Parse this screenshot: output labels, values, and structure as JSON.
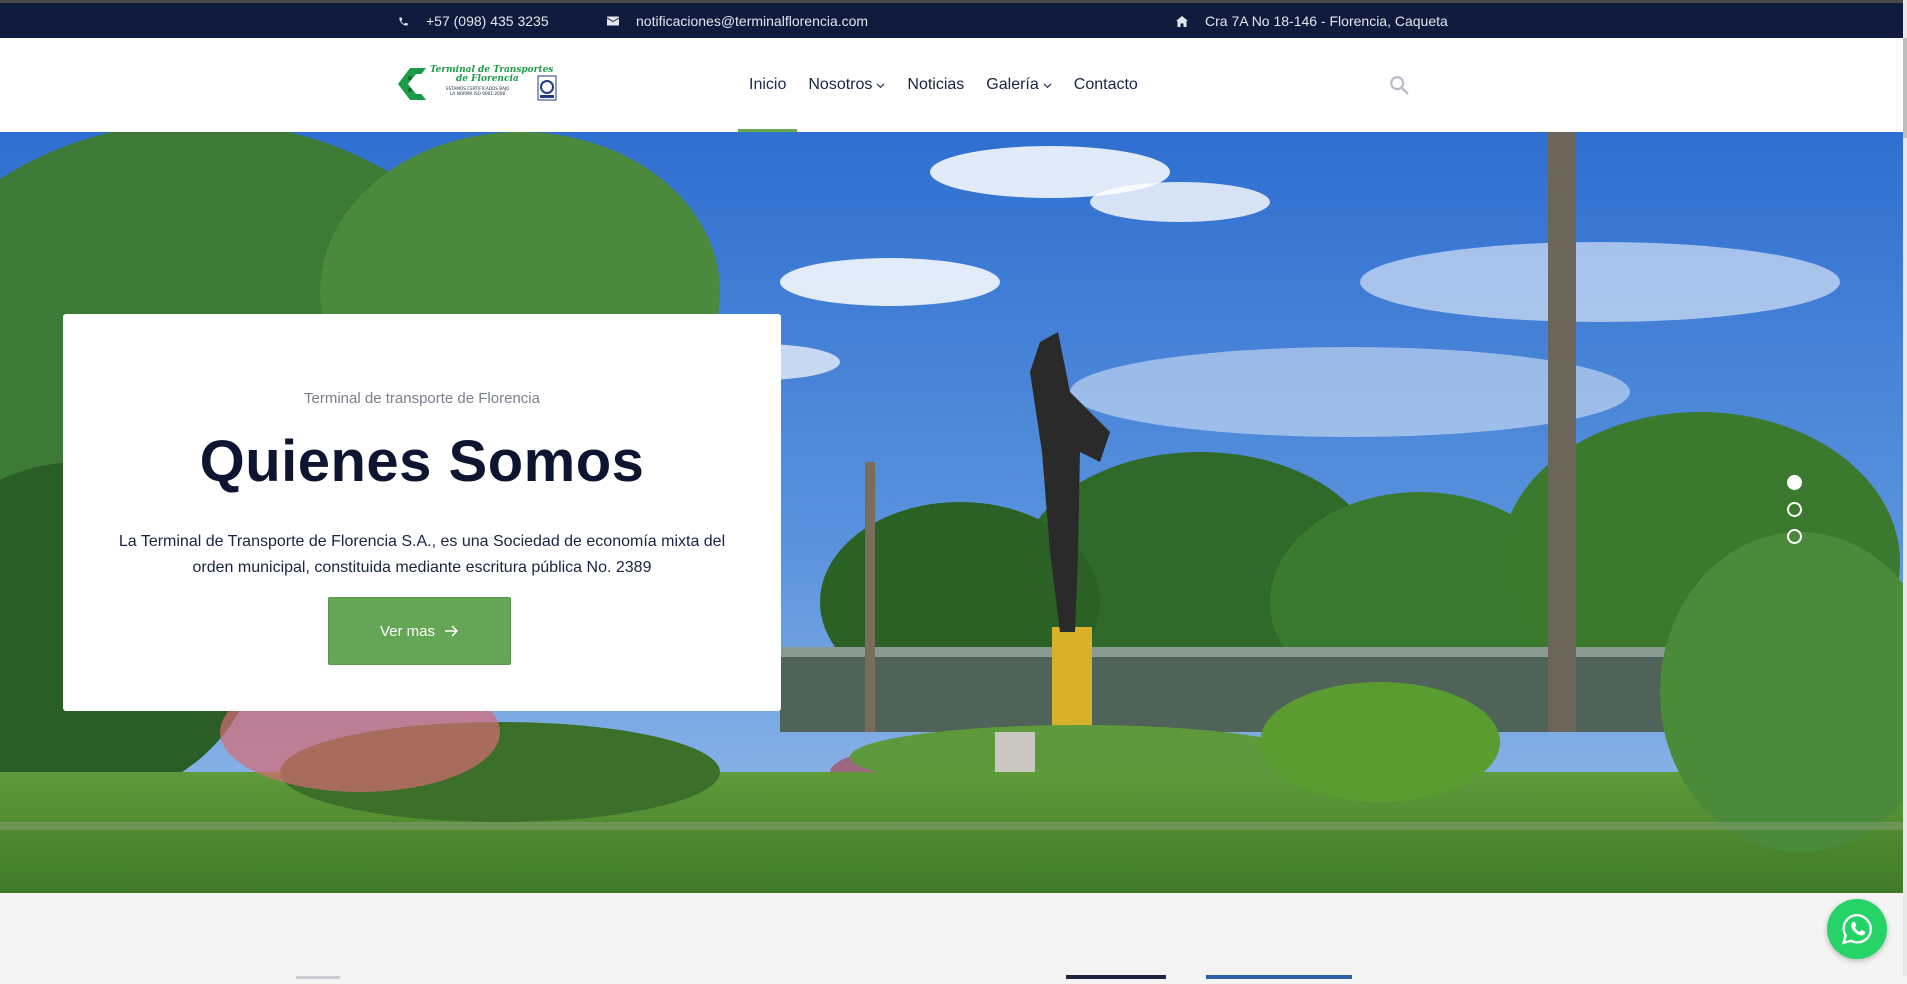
{
  "topbar": {
    "phone": "+57 (098) 435 3235",
    "email": "notificaciones@terminalflorencia.com",
    "address": "Cra 7A No 18-146 - Florencia, Caqueta",
    "icons": {
      "phone": "phone-icon",
      "email": "envelope-icon",
      "address": "home-icon"
    }
  },
  "logo": {
    "line1": "Terminal de Transportes",
    "line2": "de Florencia",
    "line3": "ESTAMOS CERTIFICADOS BAJO",
    "line4": "LA NORMA ISO 9001:2008"
  },
  "nav": {
    "items": [
      {
        "label": "Inicio",
        "active": true
      },
      {
        "label": "Nosotros",
        "dropdown": true
      },
      {
        "label": "Noticias"
      },
      {
        "label": "Galería",
        "dropdown": true
      },
      {
        "label": "Contacto"
      }
    ],
    "search_icon": "search-icon"
  },
  "hero": {
    "eyebrow": "Terminal de transporte de Florencia",
    "title": "Quienes Somos",
    "description": "La Terminal de Transporte de Florencia S.A., es una Sociedad de economía mixta del orden municipal, constituida mediante escritura pública No. 2389",
    "cta_label": "Ver mas",
    "slides": 3,
    "active_slide": 1
  },
  "colors": {
    "topbar_bg": "#0f1a3c",
    "accent_green": "#65a556",
    "title_navy": "#0d1530",
    "whatsapp": "#25d366"
  },
  "whatsapp": {
    "icon": "whatsapp-icon"
  }
}
